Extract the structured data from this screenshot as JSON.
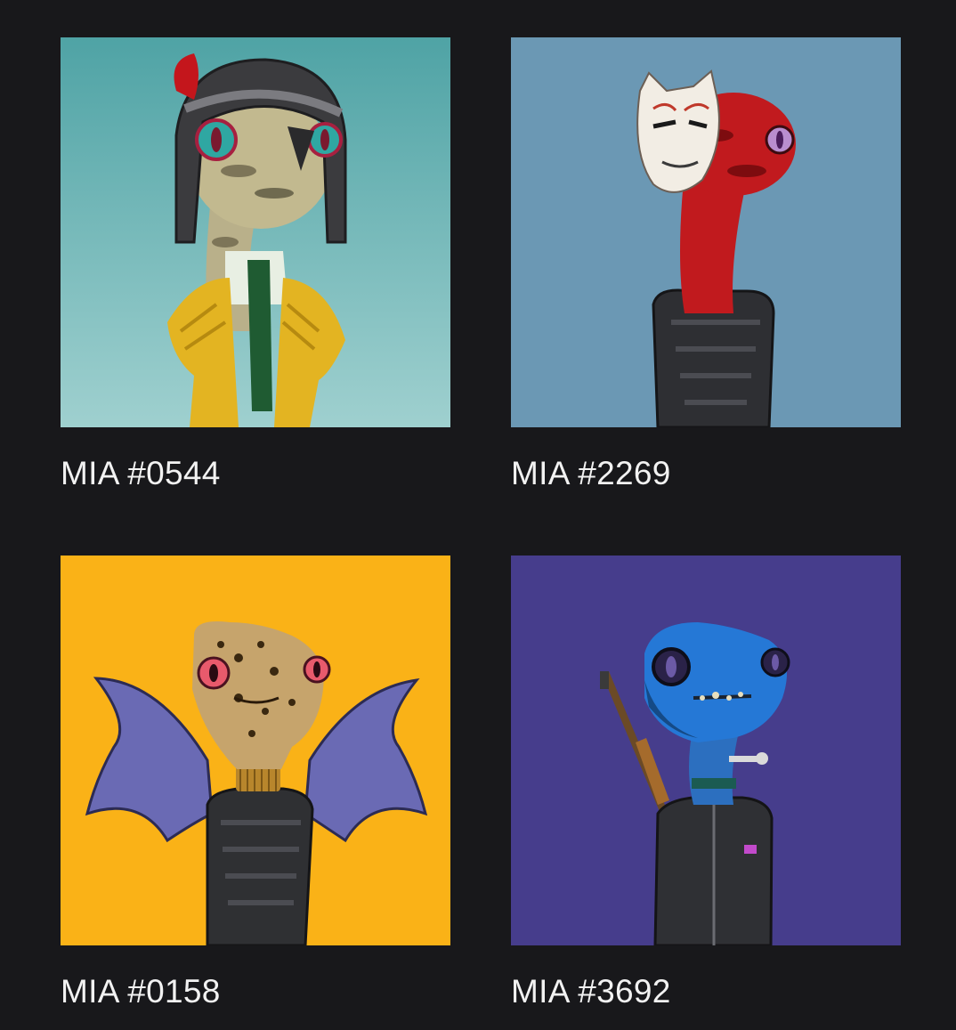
{
  "nfts": [
    {
      "title": "MIA #0544",
      "background": "#4fa3a5",
      "icon": "lizard-helmet-art"
    },
    {
      "title": "MIA #2269",
      "background": "#6b98b4",
      "icon": "lizard-kitsune-mask-art"
    },
    {
      "title": "MIA #0158",
      "background": "#fab217",
      "icon": "lizard-bat-wings-art"
    },
    {
      "title": "MIA #3692",
      "background": "#463d8c",
      "icon": "lizard-rifle-art"
    }
  ]
}
